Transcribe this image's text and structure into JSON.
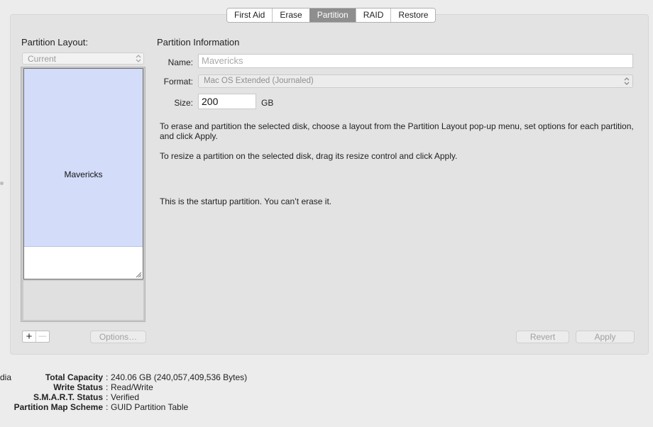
{
  "tabs": [
    {
      "label": "First Aid",
      "active": false
    },
    {
      "label": "Erase",
      "active": false
    },
    {
      "label": "Partition",
      "active": true
    },
    {
      "label": "RAID",
      "active": false
    },
    {
      "label": "Restore",
      "active": false
    }
  ],
  "layout": {
    "title": "Partition Layout:",
    "popup_value": "Current",
    "partition_name": "Mavericks",
    "add_label": "+",
    "remove_label": "—",
    "options_label": "Options…"
  },
  "info": {
    "title": "Partition Information",
    "name_label": "Name:",
    "name_value": "Mavericks",
    "format_label": "Format:",
    "format_value": "Mac OS Extended (Journaled)",
    "size_label": "Size:",
    "size_value": "200",
    "size_unit": "GB",
    "help_1": "To erase and partition the selected disk, choose a layout from the Partition Layout pop-up menu, set options for each partition, and click Apply.",
    "help_2": "To resize a partition on the selected disk, drag its resize control and click Apply.",
    "startup_note": "This is the startup partition. You can’t erase it.",
    "revert_label": "Revert",
    "apply_label": "Apply"
  },
  "disk": {
    "left_edge_text": "dia",
    "rows": [
      {
        "key": "Total Capacity",
        "value": "240.06 GB (240,057,409,536 Bytes)"
      },
      {
        "key": "Write Status",
        "value": "Read/Write"
      },
      {
        "key": "S.M.A.R.T. Status",
        "value": "Verified"
      },
      {
        "key": "Partition Map Scheme",
        "value": "GUID Partition Table"
      }
    ]
  }
}
